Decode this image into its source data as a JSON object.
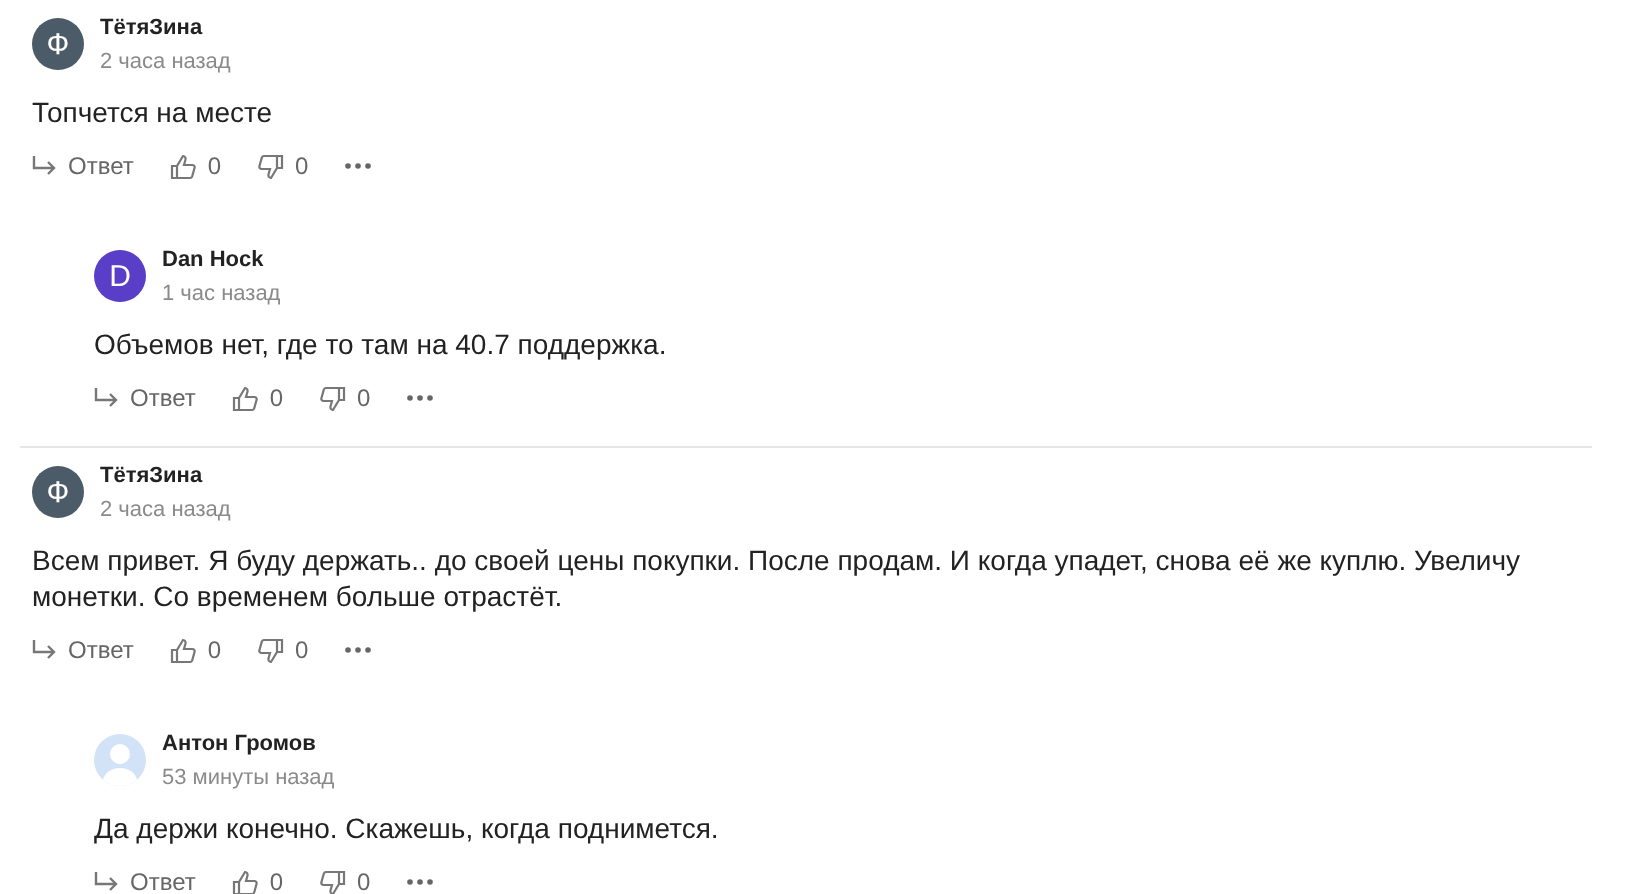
{
  "threads": [
    {
      "comment": {
        "author": "ТётяЗина",
        "avatar": {
          "kind": "letter",
          "letter": "Ф",
          "color": "#4b5b67"
        },
        "time": "2 часа назад",
        "text": "Топчется на месте",
        "reply_label": "Ответ",
        "likes": "0",
        "dislikes": "0"
      },
      "replies": [
        {
          "author": "Dan Hock",
          "avatar": {
            "kind": "letter",
            "letter": "D",
            "color": "#5a3ec8"
          },
          "time": "1 час назад",
          "text": "Объемов нет, где то там на 40.7 поддержка.",
          "reply_label": "Ответ",
          "likes": "0",
          "dislikes": "0"
        }
      ]
    },
    {
      "comment": {
        "author": "ТётяЗина",
        "avatar": {
          "kind": "letter",
          "letter": "Ф",
          "color": "#4b5b67"
        },
        "time": "2 часа назад",
        "text": "Всем привет. Я буду держать.. до своей цены покупки. После продам. И когда упадет, снова её же куплю. Увеличу монетки. Со временем больше отрастёт.",
        "reply_label": "Ответ",
        "likes": "0",
        "dislikes": "0"
      },
      "replies": [
        {
          "author": "Антон Громов",
          "avatar": {
            "kind": "silhouette",
            "color": "#d3e3f7"
          },
          "time": "53 минуты назад",
          "text": "Да держи конечно. Скажешь, когда поднимется.",
          "reply_label": "Ответ",
          "likes": "0",
          "dislikes": "0"
        }
      ]
    }
  ]
}
